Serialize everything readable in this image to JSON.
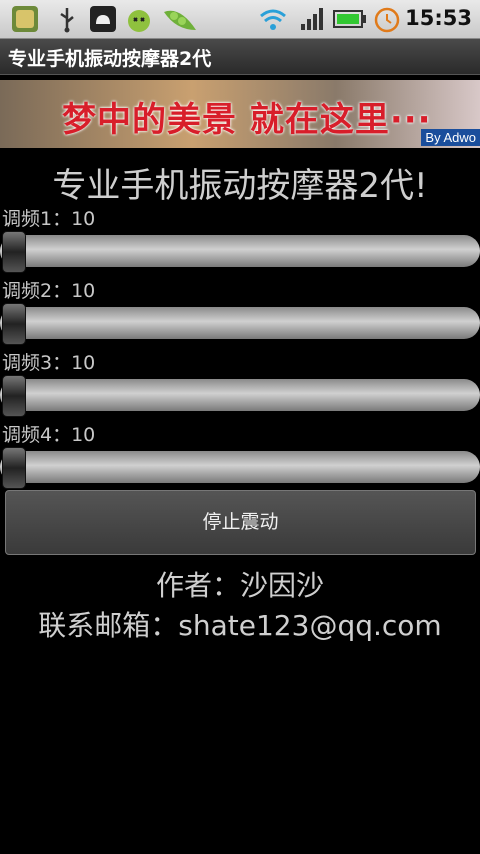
{
  "status_bar": {
    "time": "15:53",
    "icons": [
      "app-icon",
      "usb-icon",
      "android-debug-icon",
      "bugdroid-icon",
      "pea-pod-icon",
      "wifi-icon",
      "signal-icon",
      "battery-icon",
      "alarm-icon"
    ]
  },
  "app_title": "专业手机振动按摩器2代",
  "ad": {
    "text": "梦中的美景 就在这里···",
    "by": "By Adwo"
  },
  "heading": "专业手机振动按摩器2代!",
  "sliders": [
    {
      "label": "调频1：10",
      "value": 10
    },
    {
      "label": "调频2：10",
      "value": 10
    },
    {
      "label": "调频3：10",
      "value": 10
    },
    {
      "label": "调频4：10",
      "value": 10
    }
  ],
  "stop_button": "停止震动",
  "author": "作者：沙因沙",
  "contact": "联系邮箱：shate123@qq.com"
}
